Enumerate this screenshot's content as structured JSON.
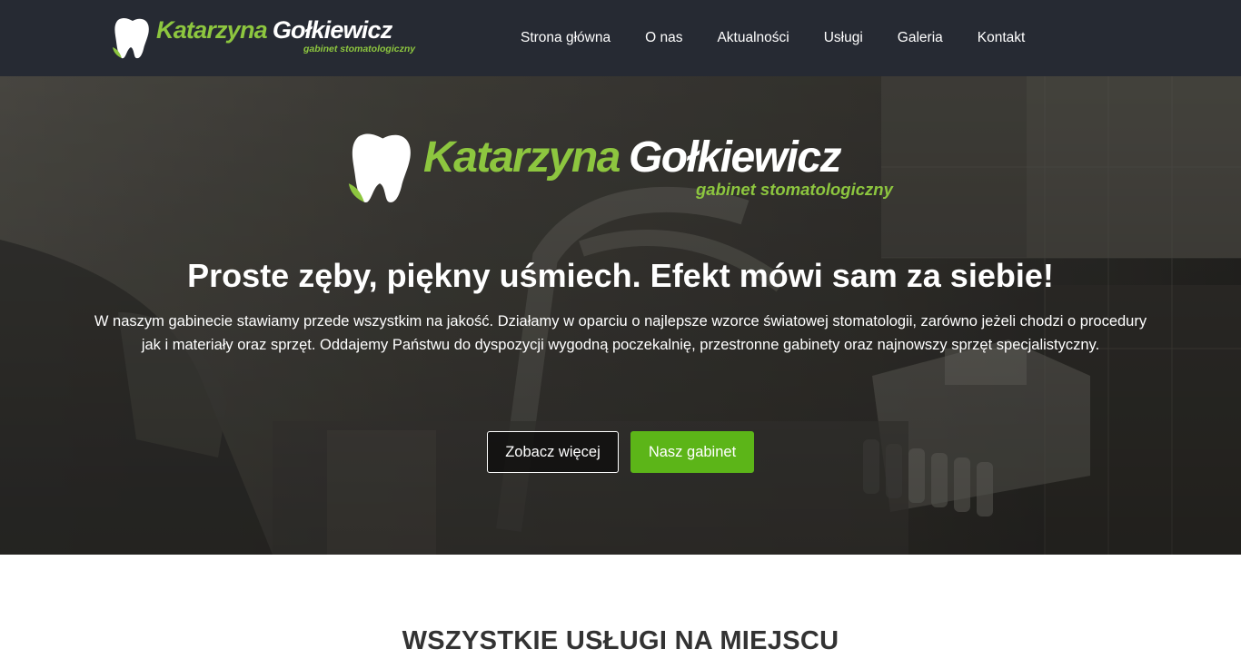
{
  "brand": {
    "name_first": "Katarzyna",
    "name_last": "Gołkiewicz",
    "subtitle": "gabinet stomatologiczny",
    "icon": "tooth-icon",
    "accent_color": "#8dc63f"
  },
  "nav": {
    "items": [
      {
        "label": "Strona główna"
      },
      {
        "label": "O nas"
      },
      {
        "label": "Aktualności"
      },
      {
        "label": "Usługi"
      },
      {
        "label": "Galeria"
      },
      {
        "label": "Kontakt"
      }
    ]
  },
  "hero": {
    "title": "Proste zęby, piękny uśmiech. Efekt mówi sam za siebie!",
    "text": "W naszym gabinecie stawiamy przede wszystkim na jakość. Działamy w oparciu o najlepsze wzorce światowej stomatologii, zarówno jeżeli chodzi o procedury jak i materiały oraz sprzęt. Oddajemy Państwu do dyspozycji wygodną poczekalnię, przestronne gabinety oraz najnowszy sprzęt specjalistyczny.",
    "button_more": "Zobacz więcej",
    "button_office": "Nasz gabinet",
    "button_color": "#5cb518"
  },
  "services": {
    "title": "WSZYSTKIE USŁUGI NA MIEJSCU"
  }
}
